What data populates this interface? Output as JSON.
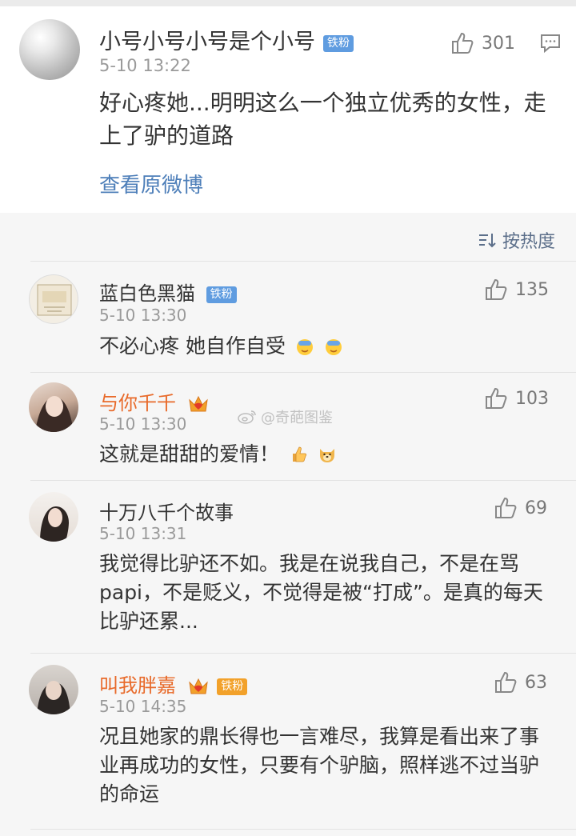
{
  "main_post": {
    "username": "小号小号小号是个小号",
    "badge": "铁粉",
    "time": "5-10 13:22",
    "likes": "301",
    "text": "好心疼她...明明这么一个独立优秀的女性，走上了驴的道路",
    "view_original": "查看原微博"
  },
  "sort": {
    "label": "按热度",
    "icon": "sort-icon"
  },
  "watermark": "@奇葩图鉴",
  "comments": [
    {
      "username": "蓝白色黑猫",
      "badge": "铁粉",
      "time": "5-10 13:30",
      "likes": "135",
      "text": "不必心疼 她自作自受",
      "emojis": [
        "facepalm-emoji",
        "facepalm-emoji"
      ]
    },
    {
      "username": "与你千千",
      "time": "5-10 13:30",
      "likes": "103",
      "text": "这就是甜甜的爱情！",
      "emojis": [
        "thumbs-up-emoji",
        "doge-emoji"
      ]
    },
    {
      "username": "十万八千个故事",
      "time": "5-10 13:31",
      "likes": "69",
      "text": "我觉得比驴还不如。我是在说我自己，不是在骂papi，不是贬义，不觉得是被“打成”。是真的每天比驴还累..."
    },
    {
      "username": "叫我胖嘉",
      "badge": "铁粉",
      "time": "5-10 14:35",
      "likes": "63",
      "text": "况且她家的鼎长得也一言难尽，我算是看出来了事业再成功的女性，只要有个驴脑，照样逃不过当驴的命运"
    }
  ],
  "colors": {
    "link": "#4e7fb9",
    "vip_name": "#e86a2a",
    "badge": "#5f9ce0",
    "time": "#9a9a9a"
  }
}
